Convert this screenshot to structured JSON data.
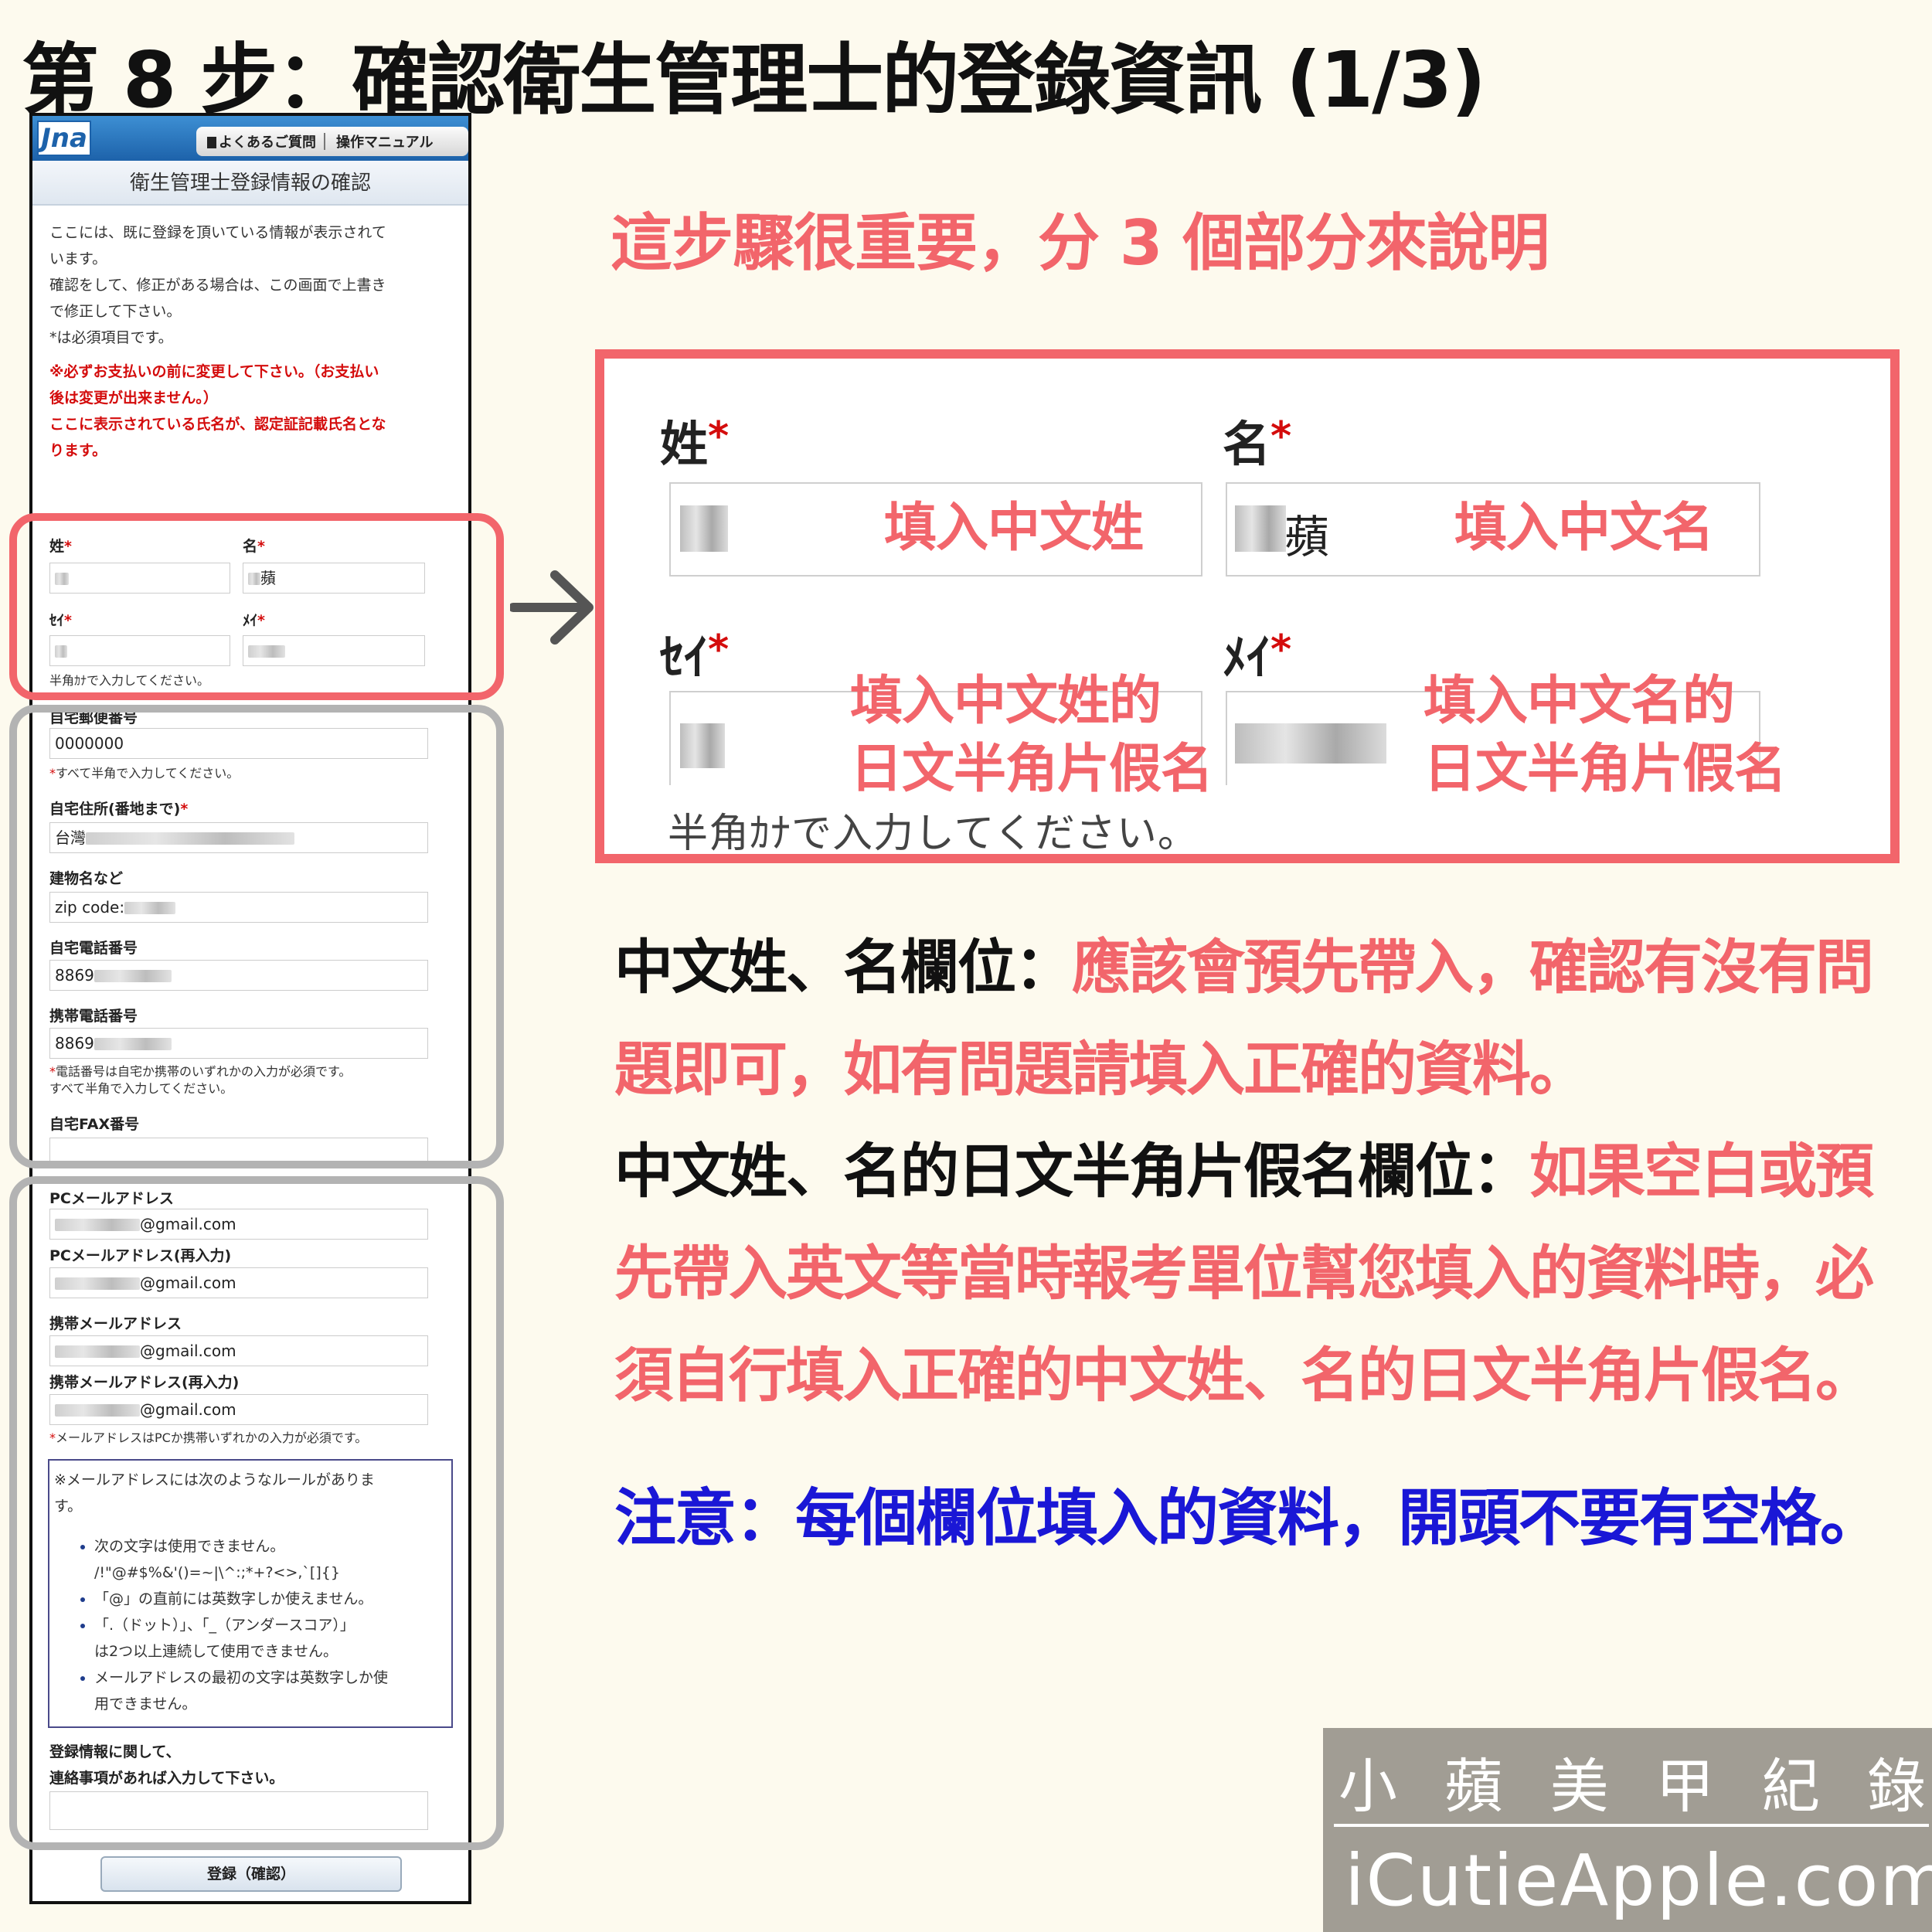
{
  "page": {
    "title": "第 8 步：確認衛生管理士的登錄資訊 (1/3)",
    "headline": "這步驟很重要，分 3 個部分來說明"
  },
  "phone": {
    "logo": "Jna",
    "nav": {
      "faq": "よくあるご質問",
      "manual": "操作マニュアル"
    },
    "subtitle": "衛生管理士登録情報の確認",
    "intro": [
      "ここには、既に登録を頂いている情報が表示されて",
      "います。",
      "確認をして、修正がある場合は、この画面で上書き",
      "で修正して下さい。",
      "*は必須項目です。"
    ],
    "note": [
      "※必ずお支払いの前に変更して下さい。（お支払い",
      "後は変更が出来ません。）",
      "ここに表示されている氏名が、認定証記載氏名とな",
      "ります。"
    ],
    "fields": {
      "sei_label": "姓",
      "mei_label": "名",
      "mei_value": "蘋",
      "sei_kana_label": "ｾｲ",
      "mei_kana_label": "ﾒｲ",
      "kana_hint": "半角ｶﾅで入力してください。",
      "postal_label": "自宅郵便番号",
      "postal_value": "0000000",
      "postal_hint": "すべて半角で入力してください。",
      "address_label": "自宅住所(番地まで)",
      "address_value": "台灣",
      "building_label": "建物名など",
      "building_value": "zip code:",
      "home_tel_label": "自宅電話番号",
      "home_tel_value": "8869",
      "mobile_tel_label": "携帯電話番号",
      "mobile_tel_value": "8869",
      "tel_hint_1": "電話番号は自宅か携帯のいずれかの入力が必須です。",
      "tel_hint_2": "すべて半角で入力してください。",
      "fax_label": "自宅FAX番号",
      "pc_mail_label": "PCメールアドレス",
      "pc_mail_value": "@gmail.com",
      "pc_mail2_label": "PCメールアドレス(再入力)",
      "pc_mail2_value": "@gmail.com",
      "mobile_mail_label": "携帯メールアドレス",
      "mobile_mail_value": "@gmail.com",
      "mobile_mail2_label": "携帯メールアドレス(再入力)",
      "mobile_mail2_value": "@gmail.com",
      "mail_hint": "メールアドレスはPCか携帯いずれかの入力が必須です。"
    },
    "rules": {
      "intro": [
        "※メールアドレスには次のようなルールがありま",
        "す。"
      ],
      "items": [
        [
          "次の文字は使用できません。",
          "/!\"@#$%&'()=~|\\^:;*+?<>,`[]{}"
        ],
        [
          "「@」の直前には英数字しか使えません。"
        ],
        [
          "「.（ドット）」、「_（アンダースコア）」",
          "は2つ以上連続して使用できません。"
        ],
        [
          "メールアドレスの最初の文字は英数字しか使",
          "用できません。"
        ]
      ]
    },
    "contact_label": [
      "登録情報に関して、",
      "連絡事項があれば入力して下さい。"
    ],
    "submit": "登録（確認）"
  },
  "zoom": {
    "sei_label": "姓",
    "mei_label": "名",
    "required_mark": "*",
    "mei_value": "蘋",
    "sei_ann": "填入中文姓",
    "mei_ann": "填入中文名",
    "sei_kana_label": "ｾｲ",
    "mei_kana_label": "ﾒｲ",
    "sei_kana_ann": [
      "填入中文姓的",
      "日文半角片假名"
    ],
    "mei_kana_ann": [
      "填入中文名的",
      "日文半角片假名"
    ],
    "hint": "半角ｶﾅで入力してください。"
  },
  "explanation": {
    "p1_key": "中文姓、名欄位：",
    "p1_text": "應該會預先帶入，確認有沒有問題即可，如有問題請填入正確的資料。",
    "p2_key": "中文姓、名的日文半角片假名欄位：",
    "p2_text": "如果空白或預先帶入英文等當時報考單位幫您填入的資料時，必須自行填入正確的中文姓、名的日文半角片假名。",
    "note": "注意：每個欄位填入的資料，開頭不要有空格。"
  },
  "brand": {
    "cn": [
      "小",
      "蘋",
      "美",
      "甲",
      "紀",
      "錄"
    ],
    "en": "iCutieApple.com"
  },
  "colors": {
    "accent_red": "#f2656b",
    "note_blue": "#1a17d6",
    "required_red": "#d40c0c",
    "highlight_gray": "#b3b3b3",
    "brand_bg": "#a19d94",
    "page_bg": "#fdfaee"
  }
}
